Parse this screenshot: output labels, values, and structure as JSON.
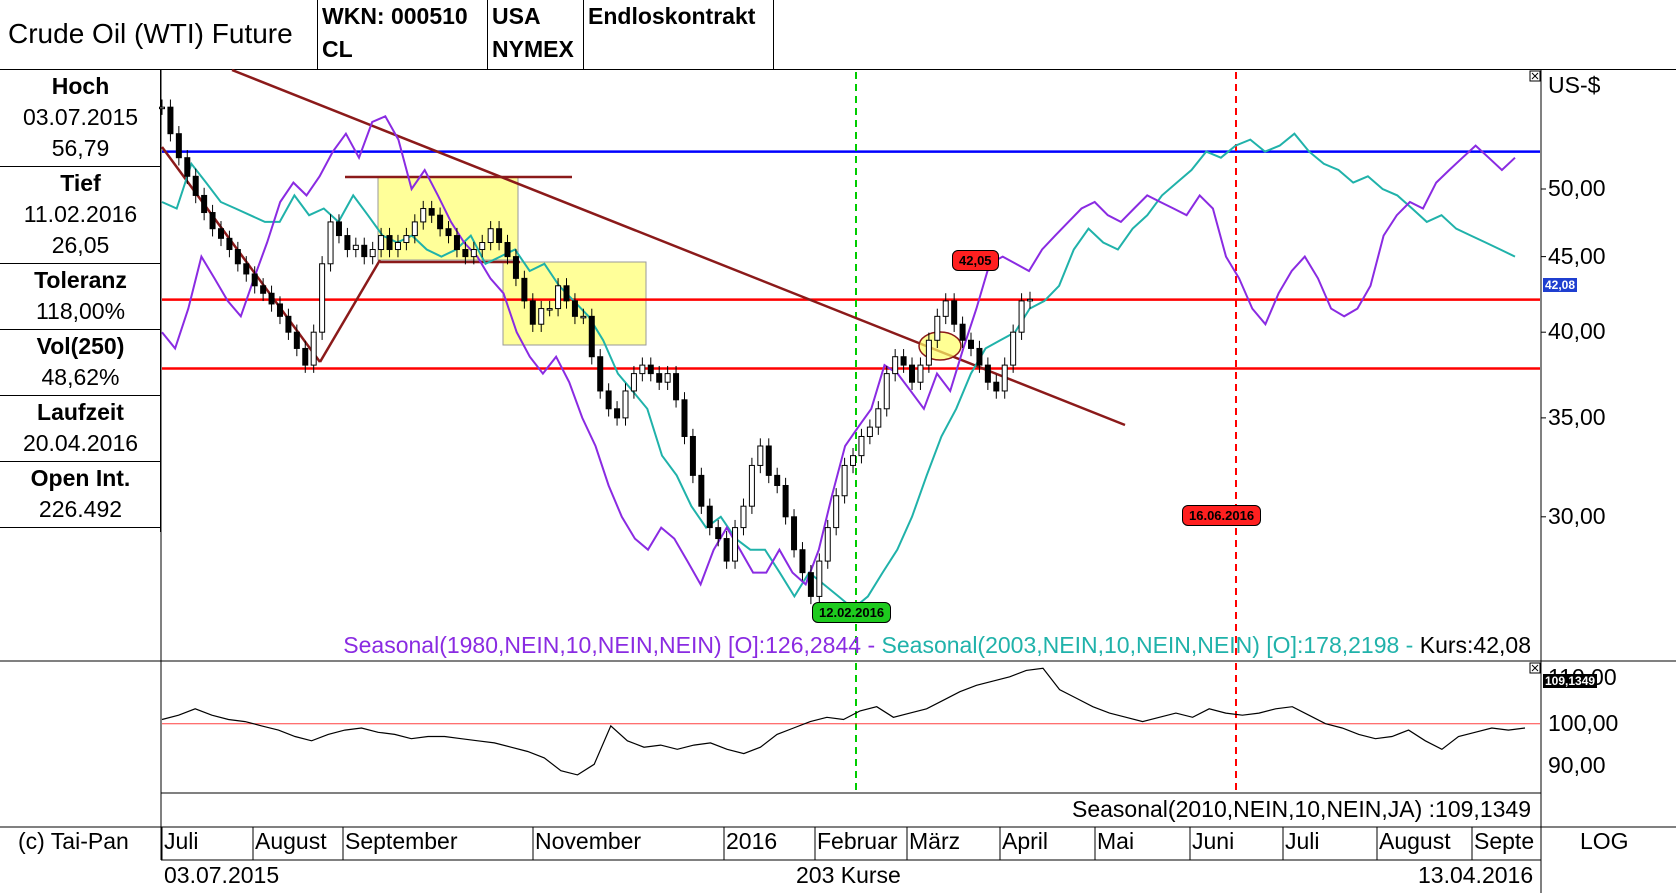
{
  "header": {
    "title": "Crude Oil (WTI) Future",
    "wkn": "WKN: 000510",
    "symbol": "CL",
    "country": "USA",
    "exchange": "NYMEX",
    "contract": "Endloskontrakt"
  },
  "stats": [
    {
      "label": "Hoch",
      "values": [
        "03.07.2015",
        "56,79"
      ]
    },
    {
      "label": "Tief",
      "values": [
        "11.02.2016",
        "26,05"
      ]
    },
    {
      "label": "Toleranz",
      "values": [
        "118,00%"
      ]
    },
    {
      "label": "Vol(250)",
      "values": [
        "48,62%"
      ]
    },
    {
      "label": "Laufzeit",
      "values": [
        "20.04.2016"
      ]
    },
    {
      "label": "Open Int.",
      "values": [
        "226.492"
      ]
    }
  ],
  "axis": {
    "unit": "US-$",
    "scale_label": "LOG",
    "current_badge": "42,08",
    "indicator_badge": "109,1349",
    "indicator_top_label": "110,00"
  },
  "annotations": {
    "peak_label": "42,05",
    "low_date": "12.02.2016",
    "expiry_date": "16.06.2016"
  },
  "legend": {
    "seasonal1": "Seasonal(1980,NEIN,10,NEIN,NEIN) [O]:126,2844",
    "sep1": " - ",
    "seasonal2": "Seasonal(2003,NEIN,10,NEIN,NEIN) [O]:178,2198",
    "sep2": " - ",
    "kurs": "Kurs:42,08",
    "indicator": "Seasonal(2010,NEIN,10,NEIN,JA) :109,1349"
  },
  "footer": {
    "copyright": "(c) Tai-Pan",
    "start_date": "03.07.2015",
    "count": "203 Kurse",
    "end_date": "13.04.2016"
  },
  "chart_data": {
    "type": "line",
    "title": "Crude Oil (WTI) Future",
    "ylabel": "US-$",
    "yscale": "log",
    "ylim": [
      24,
      60
    ],
    "yticks": [
      30,
      35,
      40,
      45,
      50
    ],
    "x_months": [
      "Juli",
      "August",
      "September",
      "November",
      "2016",
      "Februar",
      "März",
      "April",
      "Mai",
      "Juni",
      "Juli",
      "August",
      "Septe"
    ],
    "horizontal_lines": [
      {
        "value": 53.0,
        "color": "#0000ff"
      },
      {
        "value": 42.08,
        "color": "#ff0000"
      },
      {
        "value": 37.8,
        "color": "#ff0000"
      }
    ],
    "vertical_lines": [
      {
        "date": "12.02.2016",
        "color": "#00cc00"
      },
      {
        "date": "16.06.2016",
        "color": "#ff0000"
      }
    ],
    "series": [
      {
        "name": "Kurs",
        "color": "#000000",
        "values": [
          56.8,
          54.5,
          52.5,
          51.0,
          49.5,
          48.2,
          47.0,
          46.3,
          45.5,
          44.5,
          43.8,
          43.0,
          42.5,
          41.8,
          41.0,
          40.0,
          39.0,
          38.0,
          40.0,
          44.5,
          47.5,
          46.5,
          45.5,
          45.8,
          45.0,
          45.5,
          46.5,
          45.5,
          46.0,
          46.5,
          47.5,
          48.5,
          48.0,
          47.0,
          46.5,
          45.5,
          45.0,
          45.5,
          46.0,
          47.0,
          46.0,
          45.0,
          43.5,
          42.0,
          40.5,
          41.5,
          41.5,
          43.0,
          42.0,
          41.0,
          41.0,
          38.5,
          36.5,
          35.5,
          35.0,
          36.5,
          37.5,
          38.0,
          37.5,
          37.0,
          37.5,
          36.0,
          34.0,
          32.0,
          30.5,
          29.5,
          29.0,
          28.0,
          29.5,
          30.5,
          32.5,
          33.5,
          32.0,
          31.5,
          30.0,
          28.5,
          27.5,
          26.5,
          28.0,
          29.5,
          31.0,
          32.5,
          33.0,
          34.0,
          34.5,
          35.5,
          37.5,
          38.5,
          38.0,
          37.0,
          38.0,
          39.5,
          41.0,
          42.0,
          40.5,
          39.5,
          39.0,
          38.0,
          37.0,
          36.5,
          38.0,
          40.0,
          42.0,
          42.1
        ]
      },
      {
        "name": "Seasonal(1980,NEIN,10,NEIN,NEIN)",
        "color": "#8a2be2",
        "values": [
          40.0,
          39.0,
          41.5,
          45.0,
          43.5,
          42.0,
          41.0,
          43.5,
          46.0,
          49.0,
          50.5,
          49.5,
          51.0,
          53.0,
          54.5,
          52.5,
          55.5,
          56.0,
          54.0,
          50.0,
          51.5,
          49.5,
          47.5,
          46.0,
          45.0,
          43.5,
          42.5,
          40.0,
          38.5,
          37.5,
          38.5,
          37.0,
          35.0,
          33.5,
          31.5,
          30.0,
          29.0,
          28.5,
          29.5,
          29.0,
          28.0,
          27.0,
          28.5,
          29.5,
          28.5,
          27.5,
          27.5,
          28.5,
          27.5,
          27.0,
          28.5,
          31.0,
          33.5,
          34.5,
          35.5,
          38.0,
          37.5,
          36.5,
          35.5,
          37.5,
          36.5,
          39.0,
          41.5,
          44.5,
          45.0,
          44.5,
          44.0,
          45.5,
          46.5,
          47.5,
          48.5,
          49.0,
          48.0,
          47.5,
          48.5,
          49.5,
          49.0,
          48.5,
          48.0,
          49.5,
          48.5,
          45.0,
          43.5,
          41.5,
          40.5,
          42.5,
          44.0,
          45.0,
          43.5,
          41.5,
          41.0,
          41.5,
          43.0,
          46.5,
          48.0,
          49.0,
          48.5,
          50.5,
          51.5,
          52.5,
          53.5,
          52.5,
          51.5,
          52.5
        ]
      },
      {
        "name": "Seasonal(2003,NEIN,10,NEIN,NEIN)",
        "color": "#20b2aa",
        "values": [
          49.0,
          48.5,
          52.0,
          50.5,
          49.0,
          48.5,
          48.0,
          47.5,
          47.5,
          49.5,
          48.0,
          48.5,
          47.5,
          49.5,
          48.0,
          46.5,
          46.0,
          46.5,
          45.5,
          45.0,
          45.5,
          46.5,
          44.5,
          45.0,
          45.5,
          44.0,
          44.5,
          43.0,
          42.0,
          41.0,
          39.5,
          37.5,
          36.5,
          35.5,
          33.0,
          32.0,
          30.5,
          29.5,
          30.0,
          29.0,
          28.5,
          28.5,
          27.5,
          26.5,
          27.5,
          27.0,
          26.5,
          26.0,
          26.5,
          27.5,
          28.5,
          30.0,
          32.0,
          34.0,
          35.5,
          37.5,
          39.0,
          39.5,
          40.0,
          41.5,
          42.0,
          43.0,
          45.5,
          47.0,
          46.0,
          45.5,
          47.0,
          48.0,
          49.5,
          50.5,
          51.5,
          53.0,
          52.5,
          53.5,
          54.0,
          53.0,
          53.5,
          54.5,
          53.0,
          52.0,
          51.5,
          50.5,
          51.0,
          50.0,
          49.5,
          48.5,
          47.5,
          48.0,
          47.0,
          46.5,
          46.0,
          45.5,
          45.0
        ]
      }
    ],
    "indicator": {
      "name": "Seasonal(2010,NEIN,10,NEIN,JA)",
      "ylim": [
        84,
        114
      ],
      "yticks": [
        90,
        100,
        110
      ],
      "reference": 100,
      "values": [
        101,
        102,
        103.5,
        102,
        101,
        100.5,
        99.5,
        98.5,
        97,
        96,
        97.5,
        98.5,
        99,
        98,
        97.5,
        96.5,
        97,
        97,
        96.5,
        96,
        95.5,
        94.5,
        93.5,
        92,
        89,
        88,
        90.5,
        99.5,
        96,
        94.5,
        95,
        94,
        95,
        95.5,
        94,
        93,
        94.5,
        97.5,
        99,
        100.5,
        101.5,
        101,
        103,
        104,
        101.5,
        102.5,
        103.5,
        105.5,
        107.5,
        109,
        110,
        111,
        112.5,
        113,
        108,
        106,
        104,
        102.5,
        101.5,
        100.5,
        101.5,
        102.5,
        101.5,
        103.5,
        102.5,
        102,
        102.5,
        103.5,
        104,
        102,
        100,
        99,
        97.5,
        96.5,
        97,
        98.5,
        96,
        94,
        97,
        98,
        99,
        98.5,
        99
      ]
    }
  }
}
